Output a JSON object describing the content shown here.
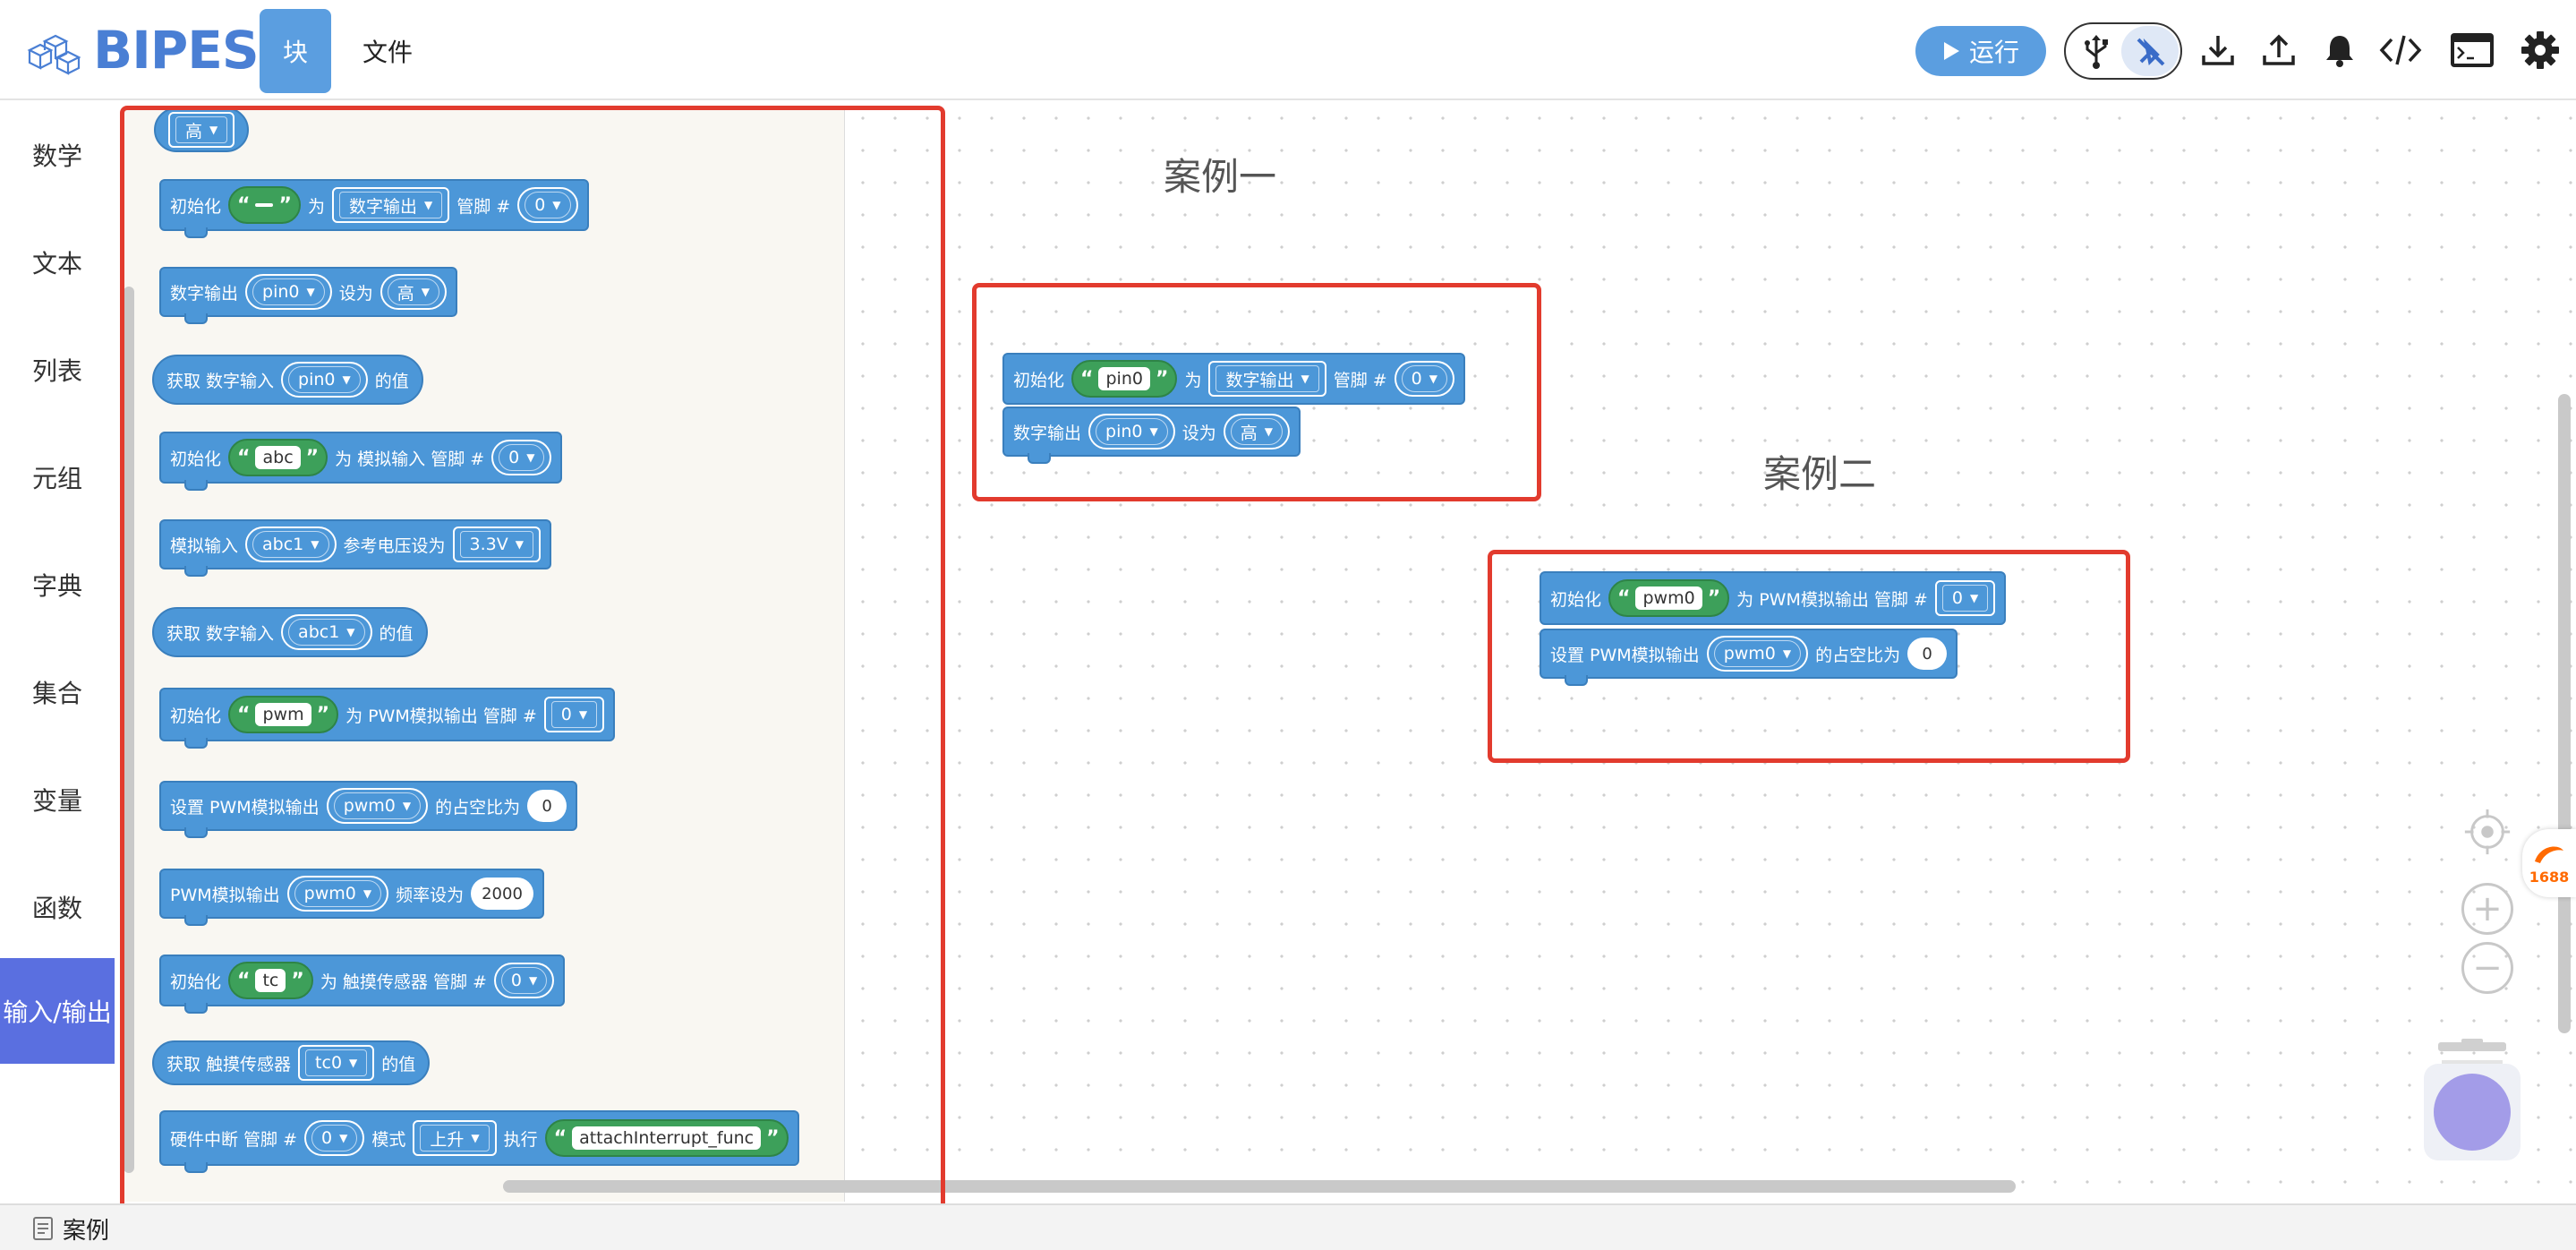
{
  "header": {
    "logo_text": "BIPES",
    "tabs": [
      {
        "label": "块"
      },
      {
        "label": "文件"
      }
    ],
    "run_label": "运行",
    "icons": [
      "usb-icon",
      "bluetooth-off-icon",
      "download-icon",
      "upload-icon",
      "bell-icon",
      "code-icon",
      "terminal-icon",
      "gear-icon"
    ]
  },
  "sidebar": {
    "items": [
      {
        "label": "数学"
      },
      {
        "label": "文本"
      },
      {
        "label": "列表"
      },
      {
        "label": "元组"
      },
      {
        "label": "字典"
      },
      {
        "label": "集合"
      },
      {
        "label": "变量"
      },
      {
        "label": "函数"
      },
      {
        "label": "输入/输出"
      }
    ],
    "active_index": 8
  },
  "flyout": {
    "b0_value": "高",
    "b1": {
      "t1": "初始化",
      "value": "",
      "t2": "为",
      "mode": "数字输出",
      "t3": "管脚 #",
      "pin": "0"
    },
    "b2": {
      "t1": "数字输出",
      "pin": "pin0",
      "t2": "设为",
      "level": "高"
    },
    "b3": {
      "t1": "获取 数字输入",
      "pin": "pin0",
      "t2": "的值"
    },
    "b4": {
      "t1": "初始化",
      "value": "abc",
      "t2": "为 模拟输入 管脚 #",
      "pin": "0"
    },
    "b5": {
      "t1": "模拟输入",
      "var": "abc1",
      "t2": "参考电压设为",
      "vref": "3.3V"
    },
    "b6": {
      "t1": "获取 数字输入",
      "var": "abc1",
      "t2": "的值"
    },
    "b7": {
      "t1": "初始化",
      "value": "pwm",
      "t2": "为 PWM模拟输出 管脚 #",
      "pin": "0"
    },
    "b8": {
      "t1": "设置 PWM模拟输出",
      "var": "pwm0",
      "t2": "的占空比为",
      "duty": "0"
    },
    "b9": {
      "t1": "PWM模拟输出",
      "var": "pwm0",
      "t2": "频率设为",
      "freq": "2000"
    },
    "b10": {
      "t1": "初始化",
      "value": "tc",
      "t2": "为 触摸传感器 管脚 #",
      "pin": "0"
    },
    "b11": {
      "t1": "获取 触摸传感器",
      "var": "tc0",
      "t2": "的值"
    },
    "b12": {
      "t1": "硬件中断 管脚 #",
      "pin": "0",
      "t2": "模式",
      "mode": "上升",
      "t3": "执行",
      "func": "attachInterrupt_func"
    }
  },
  "workspace": {
    "case1": {
      "title": "案例一",
      "init": {
        "t1": "初始化",
        "value": "pin0",
        "t2": "为",
        "mode": "数字输出",
        "t3": "管脚 #",
        "pin": "0"
      },
      "out": {
        "t1": "数字输出",
        "pin": "pin0",
        "t2": "设为",
        "level": "高"
      }
    },
    "case2": {
      "title": "案例二",
      "init": {
        "t1": "初始化",
        "value": "pwm0",
        "t2": "为 PWM模拟输出 管脚 #",
        "pin": "0"
      },
      "duty": {
        "t1": "设置 PWM模拟输出",
        "var": "pwm0",
        "t2": "的占空比为",
        "value": "0"
      }
    },
    "brand_badge": "1688"
  },
  "bottom": {
    "tab_label": "案例"
  },
  "colors": {
    "block": "#4c97d8",
    "string_block": "#3da05a",
    "highlight": "#e23b2e",
    "active_category": "#5a6fe0"
  }
}
